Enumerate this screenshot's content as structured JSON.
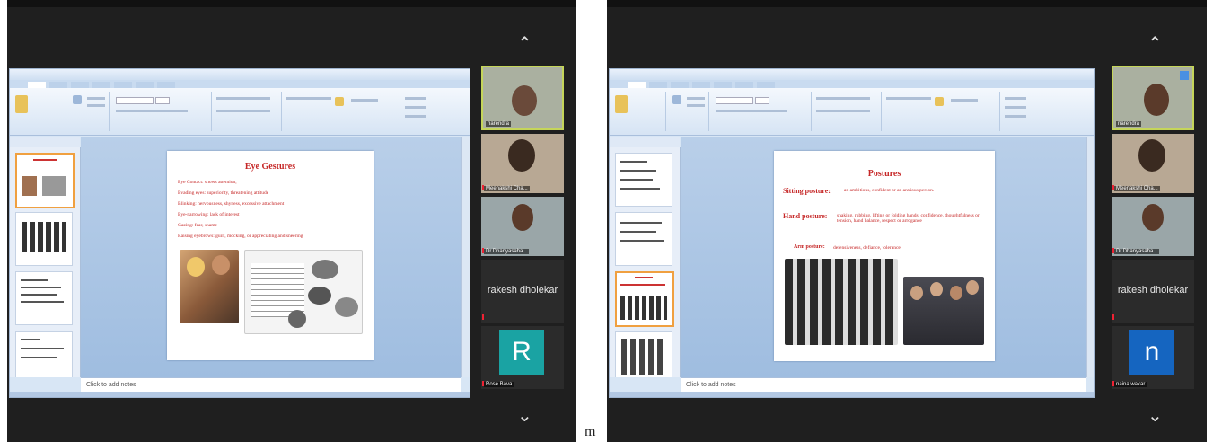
{
  "left": {
    "notes_placeholder": "Click to add notes",
    "slide": {
      "title": "Eye Gestures",
      "lines": [
        "Eye Contact: shows attention,",
        "Evading eyes: superiority, threatening attitude",
        "Blinking: nervousness, shyness, excessive attachment",
        "Eye-narrowing: lack of interest",
        "Gazing: fear, shame",
        "Raising eyebrows: guilt, mocking, or appreciating and sneering"
      ]
    },
    "participants": [
      {
        "name": "narendra"
      },
      {
        "name": "Meenakshi Cha..."
      },
      {
        "name": "Dr.Dhanyasaha..."
      },
      {
        "name": "rakesh dholekar"
      },
      {
        "name": "Rose Bava",
        "initial": "R"
      }
    ]
  },
  "right": {
    "notes_placeholder": "Click to add notes",
    "slide": {
      "title": "Postures",
      "line1_head": "Sitting posture:",
      "line1": "an ambitious, confident or an anxious person.",
      "line2_head": "Hand posture:",
      "line2": "shaking, rubbing, lifting or folding hands; confidence, thoughtfulness or tension, hand balance, respect or arrogance",
      "line3_head": "Arm posture:",
      "line3": "defensiveness, defiance, tolerance"
    },
    "participants": [
      {
        "name": "narendra"
      },
      {
        "name": "Meenakshi Cha..."
      },
      {
        "name": "Dr.Dhanyasaha..."
      },
      {
        "name": "rakesh dholekar"
      },
      {
        "name": "naina wakar",
        "initial": "n"
      }
    ]
  },
  "separator": "m",
  "icons": {
    "collapse": "chevron-up-icon",
    "expand": "chevron-down-icon"
  },
  "colors": {
    "tile_rose": "#1aa3a3",
    "tile_n": "#1565c0",
    "slide_red": "#c62828",
    "active_border": "#c5d55a"
  }
}
